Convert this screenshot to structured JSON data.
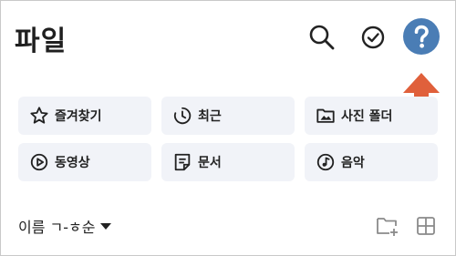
{
  "header": {
    "title": "파일",
    "icons": [
      "search-icon",
      "check-circle-icon",
      "help-icon"
    ],
    "help_color": "#4a7db5",
    "arrow_color": "#e0603b"
  },
  "quick_access": [
    {
      "label": "즐겨찾기",
      "icon": "star-icon"
    },
    {
      "label": "최근",
      "icon": "clock-icon"
    },
    {
      "label": "사진 폴더",
      "icon": "image-folder-icon"
    },
    {
      "label": "동영상",
      "icon": "play-icon"
    },
    {
      "label": "문서",
      "icon": "document-icon"
    },
    {
      "label": "음악",
      "icon": "music-icon"
    }
  ],
  "toolbar": {
    "sort_label": "이름 ㄱ-ㅎ순",
    "icons": [
      "new-folder-icon",
      "grid-view-icon"
    ]
  }
}
